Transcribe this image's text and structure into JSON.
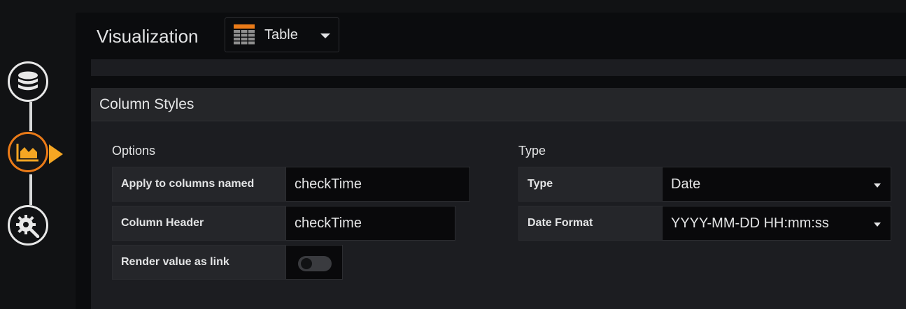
{
  "header": {
    "title": "Visualization",
    "viz_selected": "Table",
    "table_icon": "table-icon"
  },
  "sidebar": {
    "steps": [
      {
        "name": "queries",
        "icon": "database-icon",
        "active": false
      },
      {
        "name": "visualization",
        "icon": "area-chart-icon",
        "active": true
      },
      {
        "name": "general",
        "icon": "gear-wrench-icon",
        "active": false
      }
    ],
    "accent": "#eb7b18"
  },
  "section": {
    "title": "Column Styles",
    "options": {
      "title": "Options",
      "apply_label": "Apply to columns named",
      "apply_value": "checkTime",
      "header_label": "Column Header",
      "header_value": "checkTime",
      "link_label": "Render value as link",
      "link_enabled": false
    },
    "type": {
      "title": "Type",
      "type_label": "Type",
      "type_value": "Date",
      "date_format_label": "Date Format",
      "date_format_value": "YYYY-MM-DD HH:mm:ss"
    }
  }
}
